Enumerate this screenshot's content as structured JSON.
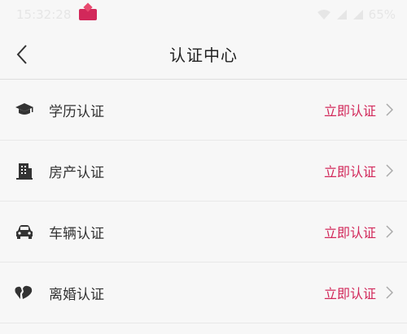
{
  "status_bar": {
    "time": "15:32:28",
    "battery": "65%"
  },
  "header": {
    "title": "认证中心"
  },
  "items": [
    {
      "label": "学历认证",
      "action": "立即认证",
      "icon": "graduation-cap-icon"
    },
    {
      "label": "房产认证",
      "action": "立即认证",
      "icon": "building-icon"
    },
    {
      "label": "车辆认证",
      "action": "立即认证",
      "icon": "car-icon"
    },
    {
      "label": "离婚认证",
      "action": "立即认证",
      "icon": "broken-heart-icon"
    }
  ],
  "colors": {
    "accent": "#d2285a",
    "icon": "#333333",
    "background": "#f7f7f7"
  }
}
